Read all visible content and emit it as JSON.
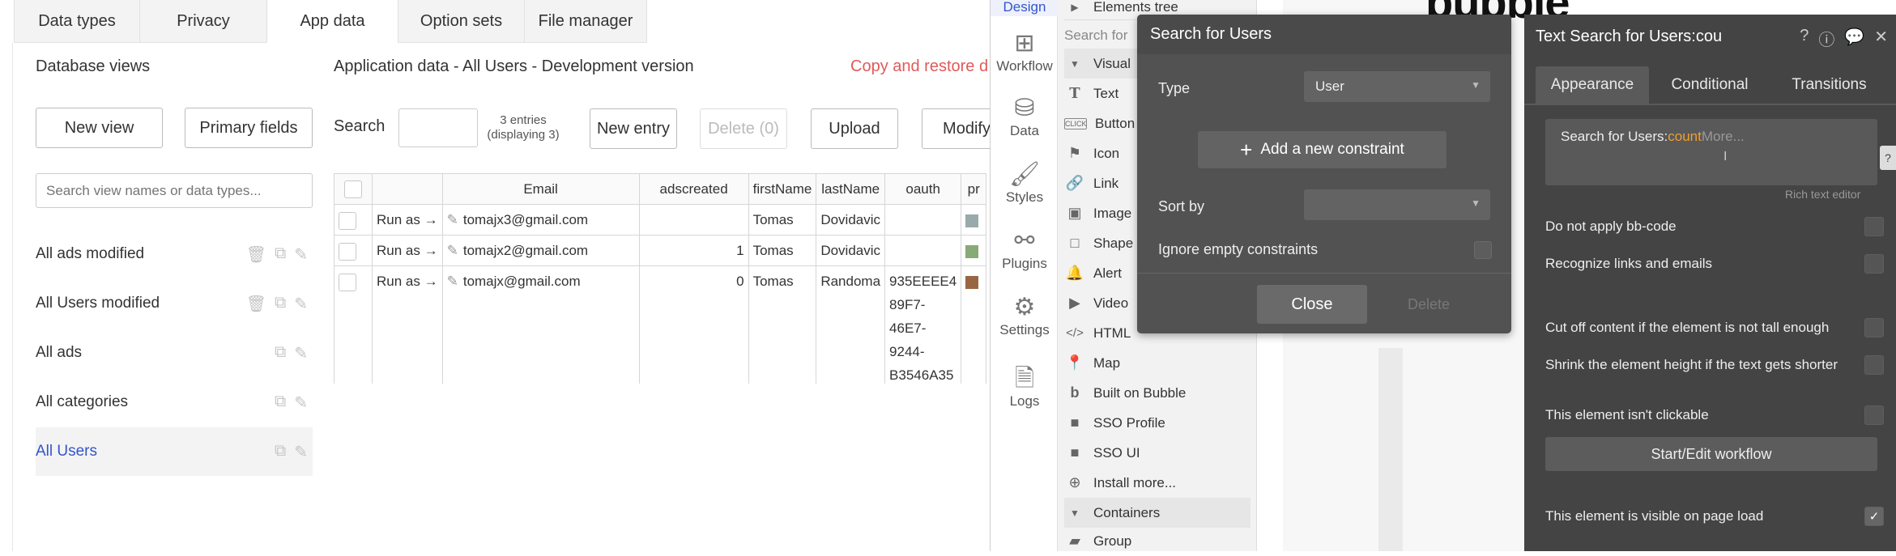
{
  "tabs": [
    "Data types",
    "Privacy",
    "App data",
    "Option sets",
    "File manager"
  ],
  "left": {
    "database_views_title": "Database views",
    "new_view": "New view",
    "primary_fields": "Primary fields",
    "search_views_placeholder": "Search view names or data types...",
    "views": [
      "All ads modified",
      "All Users modified",
      "All ads",
      "All categories",
      "All Users"
    ],
    "selected_view": "All Users"
  },
  "main": {
    "title": "Application data - All Users - Development version",
    "copy_restore": "Copy and restore d",
    "search_label": "Search",
    "entries": "3 entries",
    "displaying": "(displaying 3)",
    "new_entry": "New entry",
    "delete": "Delete (0)",
    "upload": "Upload",
    "modify": "Modify",
    "columns": [
      "Email",
      "adscreated",
      "firstName",
      "lastName",
      "oauth",
      "pr"
    ],
    "run_as": "Run as →",
    "rows": [
      {
        "email": "tomajx3@gmail.com",
        "adscreated": "",
        "first": "Tomas",
        "last": "Dovidavic",
        "oauth": ""
      },
      {
        "email": "tomajx2@gmail.com",
        "adscreated": "1",
        "first": "Tomas",
        "last": "Dovidavic",
        "oauth": ""
      },
      {
        "email": "tomajx@gmail.com",
        "adscreated": "0",
        "first": "Tomas",
        "last": "Randoma",
        "oauth_lines": [
          "935EEEE4",
          "89F7-",
          "46E7-",
          "9244-",
          "B3546A35"
        ]
      }
    ]
  },
  "vnav": [
    "Design",
    "Workflow",
    "Data",
    "Styles",
    "Plugins",
    "Settings",
    "Logs"
  ],
  "palette": {
    "elements_tree": "Elements tree",
    "search_placeholder": "Search for",
    "visual_section": "Visual",
    "items": [
      {
        "label": "Text",
        "icon": "text-icon"
      },
      {
        "label": "Button",
        "icon": "button-icon"
      },
      {
        "label": "Icon",
        "icon": "flag-icon"
      },
      {
        "label": "Link",
        "icon": "link-icon"
      },
      {
        "label": "Image",
        "icon": "image-icon"
      },
      {
        "label": "Shape",
        "icon": "shape-icon"
      },
      {
        "label": "Alert",
        "icon": "bell-icon"
      },
      {
        "label": "Video",
        "icon": "video-icon"
      },
      {
        "label": "HTML",
        "icon": "code-icon"
      },
      {
        "label": "Map",
        "icon": "pin-icon"
      },
      {
        "label": "Built on Bubble",
        "icon": "bubble-icon"
      },
      {
        "label": "SSO Profile",
        "icon": "square-icon"
      },
      {
        "label": "SSO UI",
        "icon": "square-icon"
      },
      {
        "label": "Install more...",
        "icon": "plus-circle-icon"
      }
    ],
    "containers": "Containers",
    "group": "Group"
  },
  "canvas_logo": "bubble",
  "dialog": {
    "title": "Search for Users",
    "type_label": "Type",
    "type_value": "User",
    "add_constraint": "Add a new constraint",
    "sort_by": "Sort by",
    "ignore_empty": "Ignore empty constraints",
    "close": "Close",
    "delete": "Delete"
  },
  "prop": {
    "title": "Text Search for Users:cou",
    "tabs": [
      "Appearance",
      "Conditional",
      "Transitions"
    ],
    "expr_prefix": "Search for Users:",
    "expr_op": "count",
    "expr_more": "More...",
    "rich_text": "Rich text editor",
    "options": [
      "Do not apply bb-code",
      "Recognize links and emails",
      "Cut off content if the element is not tall enough",
      "Shrink the element height if the text gets shorter",
      "This element isn't clickable"
    ],
    "workflow_btn": "Start/Edit workflow",
    "visible_label": "This element is visible on page load",
    "colors": {
      "accent": "#f0a030",
      "link": "#3355cc",
      "copy_restore": "#e05a5a"
    }
  }
}
